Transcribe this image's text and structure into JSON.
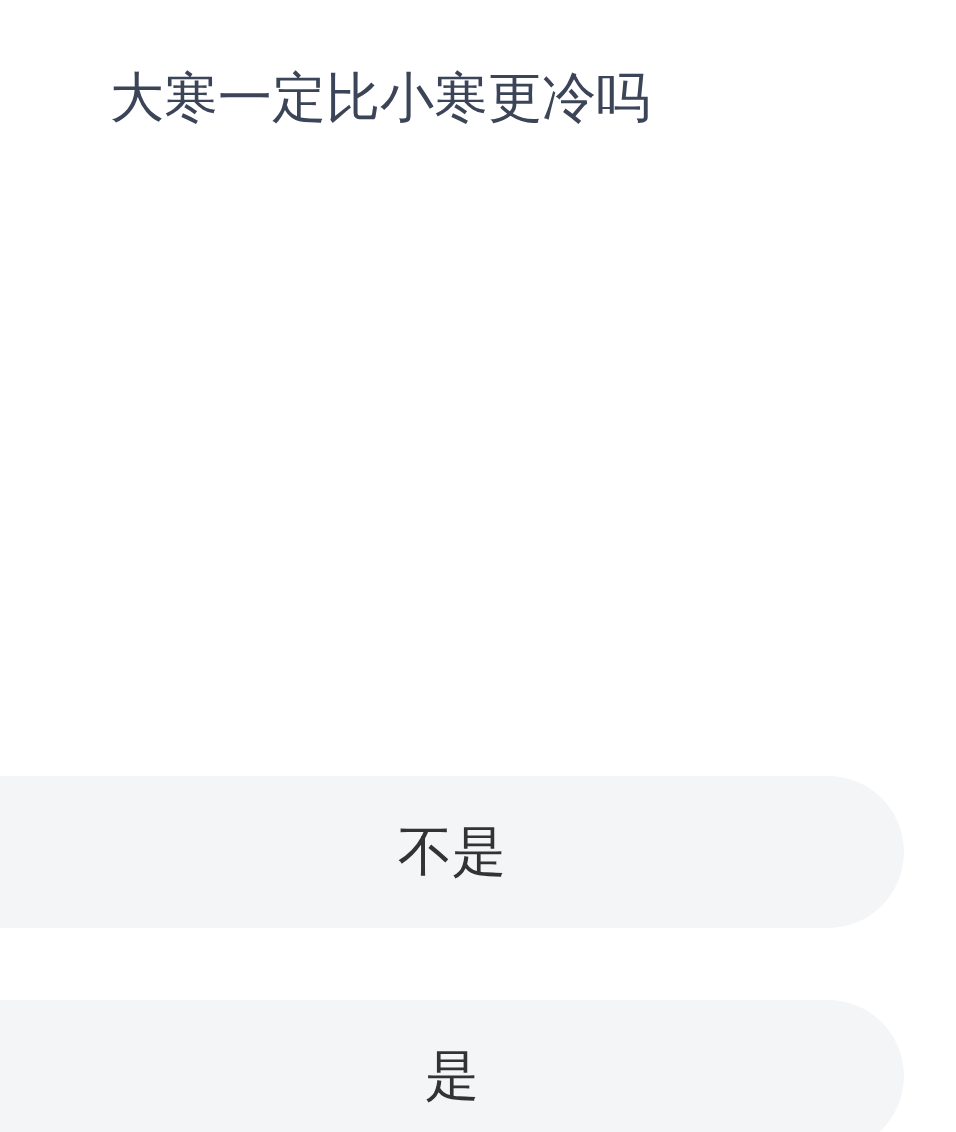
{
  "question": "大寒一定比小寒更冷吗",
  "options": [
    {
      "label": "不是"
    },
    {
      "label": "是"
    }
  ]
}
